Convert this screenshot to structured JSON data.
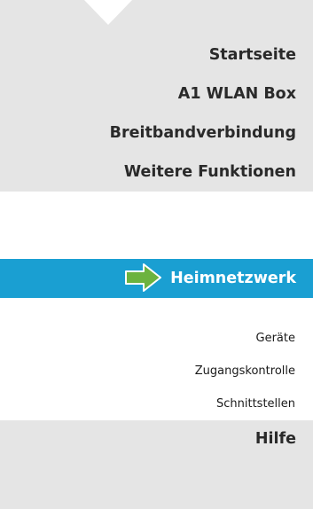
{
  "menu": {
    "items": [
      {
        "label": "Startseite"
      },
      {
        "label": "A1 WLAN Box"
      },
      {
        "label": "Breitbandverbindung"
      },
      {
        "label": "Weitere Funktionen"
      }
    ],
    "active": {
      "label": "Heimnetzwerk",
      "icon": "arrow-right-icon"
    },
    "subitems": [
      {
        "label": "Geräte"
      },
      {
        "label": "Zugangskontrolle"
      },
      {
        "label": "Schnittstellen"
      }
    ],
    "help": {
      "label": "Hilfe"
    }
  },
  "colors": {
    "menu_bg": "#e5e5e5",
    "active_bg": "#1a9fd2",
    "arrow_fill": "#6cb33f",
    "text_dark": "#2a2a2a",
    "text_active": "#ffffff",
    "sub_bg": "#ffffff"
  }
}
